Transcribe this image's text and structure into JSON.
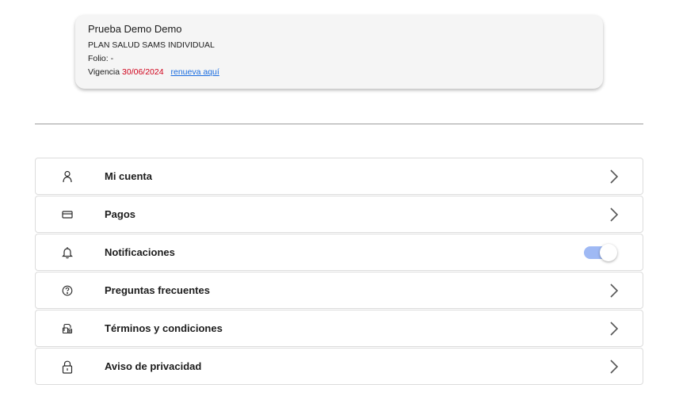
{
  "card": {
    "name": "Prueba Demo Demo",
    "plan": "PLAN SALUD SAMS INDIVIDUAL",
    "folio_label": "Folio:",
    "folio_value": "-",
    "vigencia_label": "Vigencia",
    "vigencia_date": "30/06/2024",
    "renew_link": "renueva aquí"
  },
  "menu": {
    "items": [
      {
        "label": "Mi cuenta",
        "icon": "user-icon"
      },
      {
        "label": "Pagos",
        "icon": "credit-card-icon"
      },
      {
        "label": "Notificaciones",
        "icon": "bell-icon",
        "toggle_on": true
      },
      {
        "label": "Preguntas frecuentes",
        "icon": "question-circle-icon"
      },
      {
        "label": "Términos y condiciones",
        "icon": "terms-icon"
      },
      {
        "label": "Aviso de privacidad",
        "icon": "lock-icon"
      }
    ]
  },
  "colors": {
    "date": "#d0021b",
    "link": "#1a6de0",
    "toggle_track": "#9fb9f4"
  }
}
